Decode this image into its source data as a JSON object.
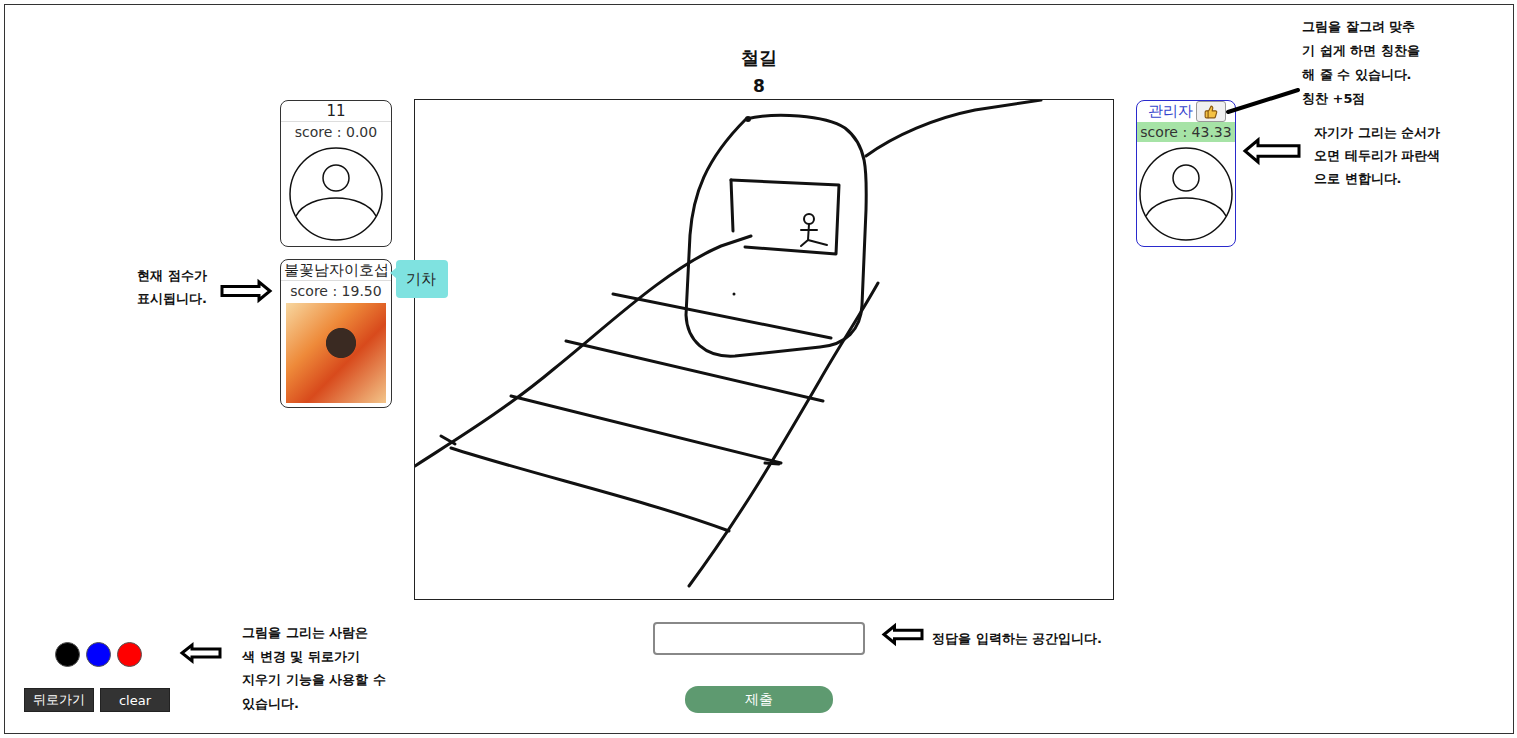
{
  "word": "철길",
  "timer": "8",
  "players_left": [
    {
      "name": "11",
      "score": "score : 0.00",
      "avatar": "default",
      "turn": false,
      "score_highlight": false,
      "praise_button": false,
      "bubble": ""
    },
    {
      "name": "불꽃남자이호섭",
      "score": "score : 19.50",
      "avatar": "photo",
      "turn": false,
      "score_highlight": false,
      "praise_button": false,
      "bubble": "기차"
    }
  ],
  "players_right": [
    {
      "name": "관리자",
      "score": "score : 43.33",
      "avatar": "default",
      "turn": true,
      "score_highlight": true,
      "praise_button": true,
      "bubble": ""
    }
  ],
  "palette": [
    {
      "color": "#000000"
    },
    {
      "color": "#0000ff"
    },
    {
      "color": "#ff0000"
    }
  ],
  "tool_buttons": [
    "뒤로가기",
    "clear"
  ],
  "answer_input": {
    "value": ""
  },
  "submit": "제출",
  "annotations": [
    {
      "kind": "line",
      "lines": [
        "그림을 잘그려 맞추",
        "기 쉽게 하면 칭찬을",
        "해 줄 수 있습니다.",
        "칭찬 +5점"
      ]
    },
    {
      "kind": "arrow-left",
      "lines": [
        "자기가 그리는 순서가",
        "오면 테두리가 파란색",
        "으로 변합니다."
      ]
    },
    {
      "kind": "arrow-right",
      "lines": [
        "현재 점수가",
        "표시됩니다."
      ]
    },
    {
      "kind": "arrow-left",
      "lines": [
        "그림을 그리는 사람은",
        "색 변경 및 뒤로가기",
        "지우기 기능을 사용할 수",
        "있습니다."
      ]
    },
    {
      "kind": "arrow-left",
      "lines": [
        "정답을 입력하는 공간입니다."
      ]
    }
  ]
}
